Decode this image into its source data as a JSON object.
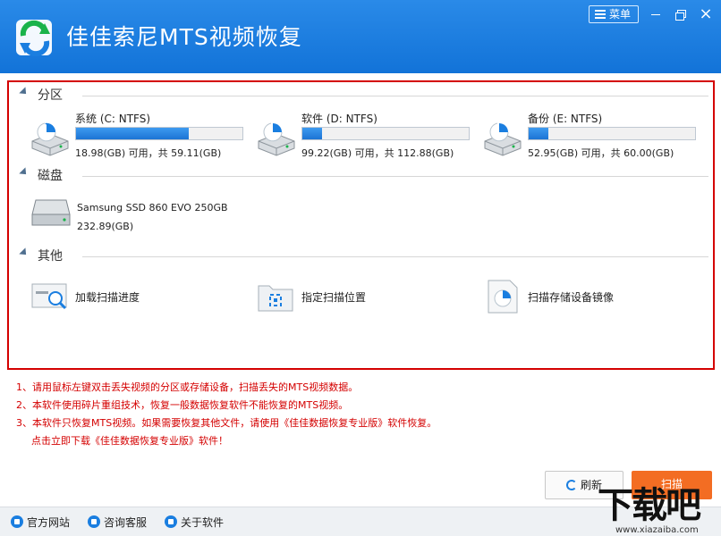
{
  "window": {
    "title": "佳佳索尼MTS视频恢复",
    "menu_label": "菜单",
    "close_glyph": "×"
  },
  "sections": {
    "partition": "分区",
    "disk": "磁盘",
    "other": "其他"
  },
  "partitions": [
    {
      "name": "系统 (C: NTFS)",
      "size": "18.98(GB) 可用，共 59.11(GB)",
      "used_fraction": 0.68
    },
    {
      "name": "软件 (D: NTFS)",
      "size": "99.22(GB) 可用，共 112.88(GB)",
      "used_fraction": 0.12
    },
    {
      "name": "备份 (E: NTFS)",
      "size": "52.95(GB) 可用，共 60.00(GB)",
      "used_fraction": 0.12
    }
  ],
  "disk": {
    "name": "Samsung SSD 860 EVO 250GB",
    "size": "232.89(GB)"
  },
  "other_items": [
    {
      "label": "加载扫描进度",
      "icon": "load-progress-icon"
    },
    {
      "label": "指定扫描位置",
      "icon": "scan-location-icon"
    },
    {
      "label": "扫描存储设备镜像",
      "icon": "device-image-icon"
    }
  ],
  "notes": [
    "1、请用鼠标左键双击丢失视频的分区或存储设备，扫描丢失的MTS视频数据。",
    "2、本软件使用碎片重组技术，恢复一般数据恢复软件不能恢复的MTS视频。",
    "3、本软件只恢复MTS视频。如果需要恢复其他文件，请使用《佳佳数据恢复专业版》软件恢复。",
    "点击立即下载《佳佳数据恢复专业版》软件！"
  ],
  "buttons": {
    "refresh": "刷新",
    "scan": "扫描"
  },
  "footer": {
    "website": "官方网站",
    "support": "咨询客服",
    "about": "关于软件"
  },
  "watermark": {
    "text": "下载吧",
    "sub": "www.xiazaiba.com"
  },
  "colors": {
    "titlebar": "#1a7ee0",
    "frame_border": "#d40000",
    "notes": "#d40000",
    "scan_button": "#f36d23",
    "bar_fill": "#1c74d4"
  }
}
